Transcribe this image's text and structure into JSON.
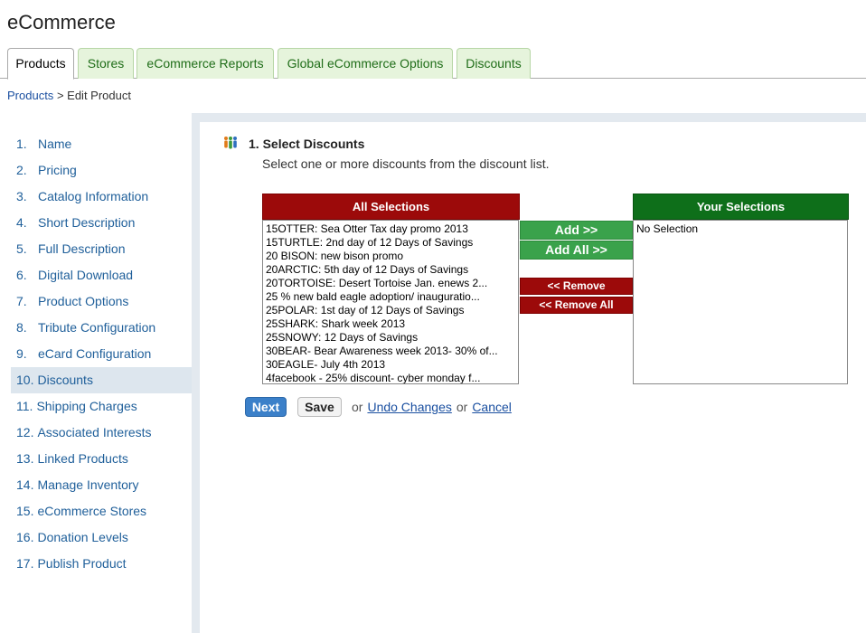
{
  "app": {
    "title": "eCommerce"
  },
  "tabs": [
    {
      "label": "Products",
      "active": true
    },
    {
      "label": "Stores",
      "active": false
    },
    {
      "label": "eCommerce Reports",
      "active": false
    },
    {
      "label": "Global eCommerce Options",
      "active": false
    },
    {
      "label": "Discounts",
      "active": false
    }
  ],
  "breadcrumb": {
    "link": "Products",
    "separator": ">",
    "current": "Edit Product"
  },
  "sidebar": {
    "items": [
      {
        "num": "1.",
        "label": "Name"
      },
      {
        "num": "2.",
        "label": "Pricing"
      },
      {
        "num": "3.",
        "label": "Catalog Information"
      },
      {
        "num": "4.",
        "label": "Short Description"
      },
      {
        "num": "5.",
        "label": "Full Description"
      },
      {
        "num": "6.",
        "label": "Digital Download"
      },
      {
        "num": "7.",
        "label": "Product Options"
      },
      {
        "num": "8.",
        "label": "Tribute Configuration"
      },
      {
        "num": "9.",
        "label": "eCard Configuration"
      },
      {
        "num": "10.",
        "label": "Discounts",
        "active": true
      },
      {
        "num": "11.",
        "label": "Shipping Charges"
      },
      {
        "num": "12.",
        "label": "Associated Interests"
      },
      {
        "num": "13.",
        "label": "Linked Products"
      },
      {
        "num": "14.",
        "label": "Manage Inventory"
      },
      {
        "num": "15.",
        "label": "eCommerce Stores"
      },
      {
        "num": "16.",
        "label": "Donation Levels"
      },
      {
        "num": "17.",
        "label": "Publish Product"
      }
    ]
  },
  "section": {
    "icon": "people-icon",
    "title": "1. Select Discounts",
    "description": "Select one or more discounts from the discount list."
  },
  "all_selections": {
    "header": "All Selections",
    "options": [
      "15OTTER: Sea Otter Tax day promo 2013",
      "15TURTLE: 2nd day of 12 Days of Savings",
      "20 BISON: new bison promo",
      "20ARCTIC: 5th day of 12 Days of Savings",
      "20TORTOISE: Desert Tortoise Jan. enews 2...",
      "25 % new bald eagle adoption/ inauguratio...",
      "25POLAR: 1st day of 12 Days of Savings",
      "25SHARK: Shark week 2013",
      "25SNOWY: 12 Days of Savings",
      "30BEAR- Bear Awareness week 2013- 30% of...",
      "30EAGLE- July 4th 2013",
      "4facebook - 25% discount- cyber monday f..."
    ]
  },
  "your_selections": {
    "header": "Your Selections",
    "options": [
      "No Selection"
    ]
  },
  "transfer": {
    "add": "Add >>",
    "add_all": "Add All >>",
    "remove": "<< Remove",
    "remove_all": "<< Remove All"
  },
  "actions": {
    "next": "Next",
    "save": "Save",
    "or1": "or",
    "undo": "Undo Changes",
    "or2": "or",
    "cancel": "Cancel"
  },
  "colors": {
    "tab_green_bg": "#e6f4dc",
    "all_header": "#9c0a0a",
    "your_header": "#0e6f1a",
    "add_button": "#3aa24b",
    "next_button": "#3b80c9",
    "link": "#1a4fa0"
  }
}
